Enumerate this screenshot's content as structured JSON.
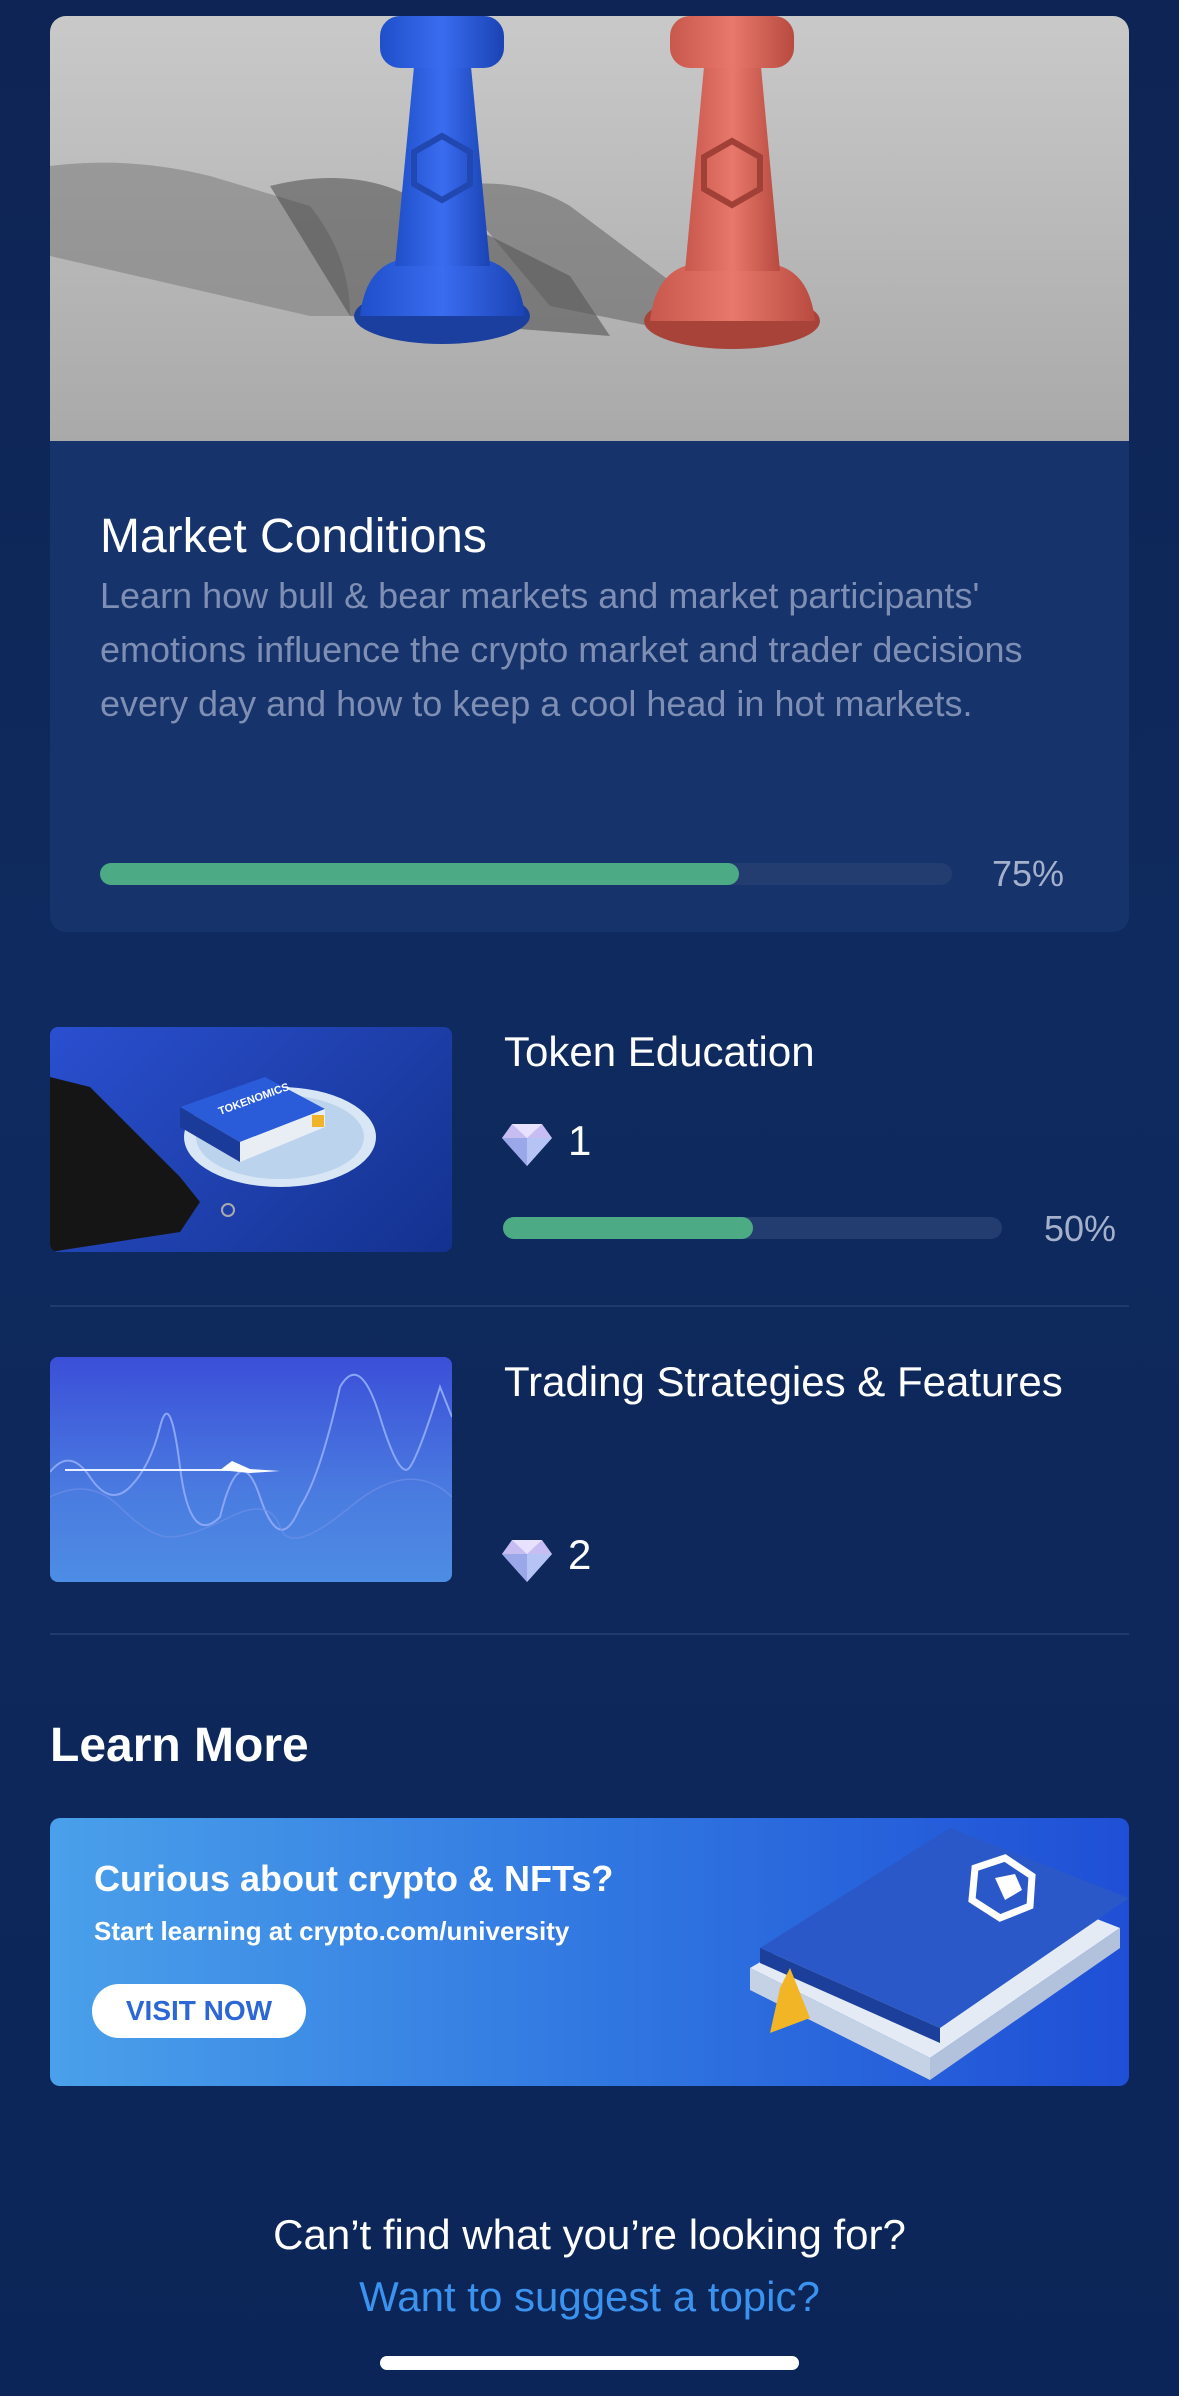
{
  "featured": {
    "title": "Market Conditions",
    "description": "Learn how bull & bear markets and market participants' emotions influence the crypto market and trader decisions every day and how to keep a cool head in hot markets.",
    "progress": 0.75,
    "progress_label": "75%"
  },
  "courses": [
    {
      "title": "Token Education",
      "gems": "1",
      "progress": 0.5,
      "progress_label": "50%",
      "thumb_text": "TOKENOMICS"
    },
    {
      "title": "Trading Strategies & Features",
      "gems": "2"
    }
  ],
  "learn_more": {
    "title": "Learn More",
    "banner_heading": "Curious about crypto & NFTs?",
    "banner_sub": "Start learning at crypto.com/university",
    "banner_button": "VISIT NOW"
  },
  "footer": {
    "question": "Can’t find what you’re looking for?",
    "link": "Want to suggest a topic?"
  },
  "colors": {
    "progress": "#4caa85",
    "link": "#3b93f0",
    "background": "#0e2454"
  }
}
